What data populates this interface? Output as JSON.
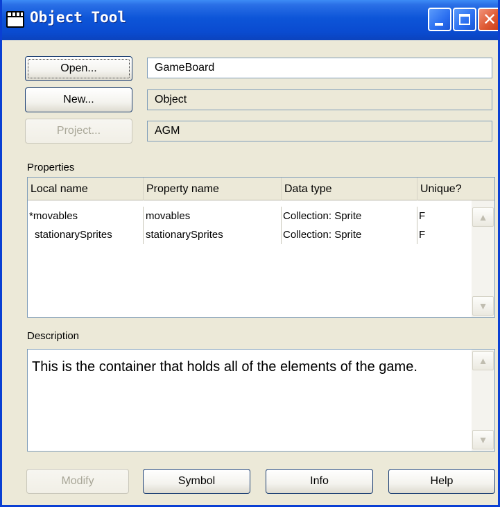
{
  "window": {
    "title": "Object Tool"
  },
  "buttons": {
    "open": "Open...",
    "new": "New...",
    "project": "Project...",
    "modify": "Modify",
    "symbol": "Symbol",
    "info": "Info",
    "help": "Help"
  },
  "fields": {
    "name": "GameBoard",
    "type": "Object",
    "project": "AGM"
  },
  "properties": {
    "label": "Properties",
    "columns": [
      "Local name",
      "Property name",
      "Data type",
      "Unique?"
    ],
    "rows": [
      [
        "*movables",
        "movables",
        "Collection: Sprite",
        "F"
      ],
      [
        "stationarySprites",
        "stationarySprites",
        "Collection: Sprite",
        "F"
      ]
    ]
  },
  "description": {
    "label": "Description",
    "text": "This is the container that holds all of the elements of the game."
  },
  "icons": {
    "title": "window-app-icon",
    "scroll_up": "▲",
    "scroll_down": "▼"
  }
}
